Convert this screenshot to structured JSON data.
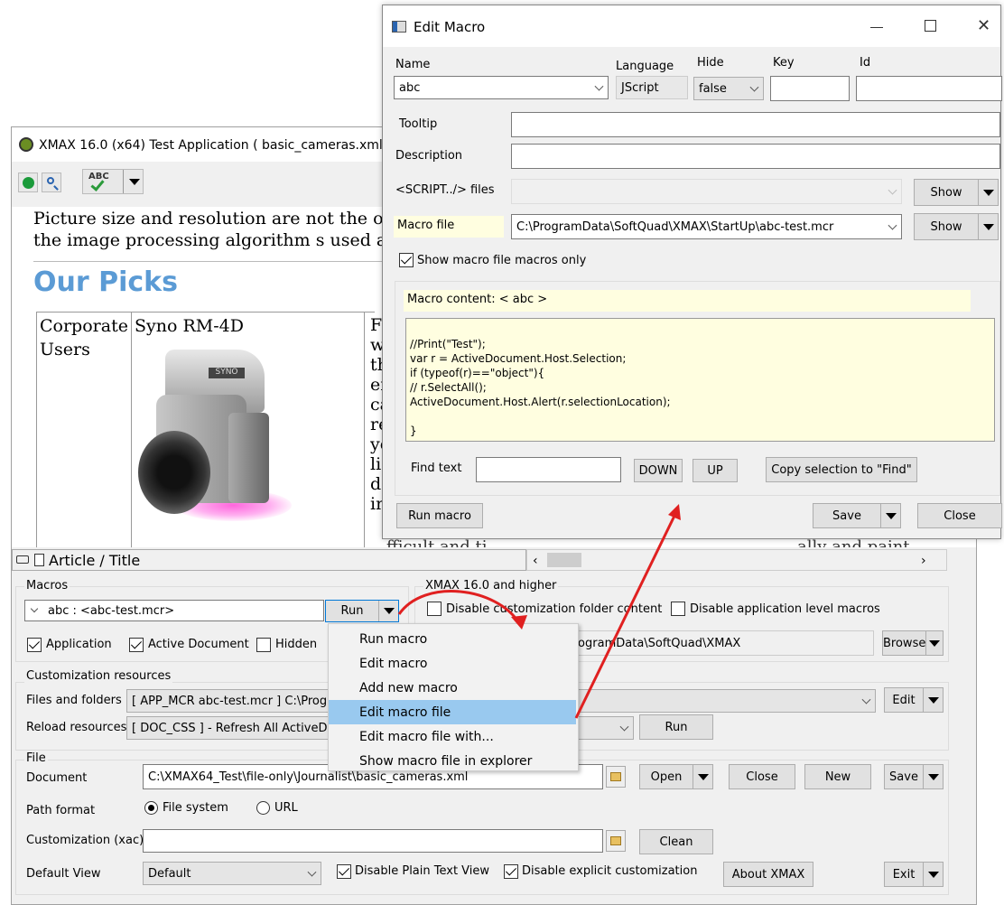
{
  "main": {
    "title": "XMAX 16.0 (x64) Test Application ( basic_cameras.xml )",
    "doc": {
      "para_line1": "Picture size and resolution are not the onl",
      "para_line2": "the image processing algorithm s used also",
      "heading": "Our Picks",
      "cell1_line1": "Corporate",
      "cell1_line2": "Users",
      "cell2": "Syno RM-4D",
      "col3_letters": [
        "F",
        "w",
        "th",
        "er",
        "ca",
        "re",
        "yo",
        "li",
        "d",
        "in"
      ],
      "bottom_text": "fficult and ti",
      "bottom_text2": "ally and paint"
    },
    "status_path": "Article / Title",
    "macros": {
      "label": "Macros",
      "selected": "abc  :  <abc-test.mcr>",
      "run": "Run",
      "application": "Application",
      "active_document": "Active Document",
      "hidden": "Hidden"
    },
    "xmax16": {
      "label": "XMAX 16.0 and higher",
      "disable_custom": "Disable customization folder content",
      "disable_app_macros": "Disable application level macros",
      "path": "rogramData\\SoftQuad\\XMAX",
      "browse": "Browse"
    },
    "custom_res": {
      "label": "Customization resources",
      "files_label": "Files and folders",
      "files_value": "[ APP_MCR abc-test.mcr ]  C:\\Prog",
      "edit": "Edit",
      "reload_label": "Reload resources",
      "reload_value": "[ DOC_CSS  ] - Refresh All ActiveD",
      "run": "Run"
    },
    "file": {
      "label": "File",
      "document_label": "Document",
      "document_value": "C:\\XMAX64_Test\\file-only\\Journalist\\basic_cameras.xml",
      "open": "Open",
      "close": "Close",
      "new": "New",
      "save": "Save",
      "path_format_label": "Path format",
      "file_system": "File system",
      "url": "URL",
      "customization_label": "Customization (xac)",
      "clean": "Clean",
      "default_view_label": "Default View",
      "default_view_value": "Default",
      "disable_plain": "Disable Plain Text View",
      "disable_explicit": "Disable explicit customization",
      "about": "About XMAX",
      "exit": "Exit"
    }
  },
  "menu": {
    "items": [
      "Run macro",
      "Edit macro",
      "Add new macro",
      "Edit macro file",
      "Edit macro file with...",
      "Show macro file in explorer"
    ],
    "highlighted_index": 3,
    "highlight_color": "#99c9ef"
  },
  "dialog": {
    "title": "Edit Macro",
    "name_label": "Name",
    "name_value": "abc",
    "language_label": "Language",
    "language_value": "JScript",
    "hide_label": "Hide",
    "hide_value": "false",
    "key_label": "Key",
    "id_label": "Id",
    "tooltip_label": "Tooltip",
    "description_label": "Description",
    "script_files_label": "<SCRIPT../> files",
    "show": "Show",
    "macro_file_label": "Macro file",
    "macro_file_value": "C:\\ProgramData\\SoftQuad\\XMAX\\StartUp\\abc-test.mcr",
    "show_only": "Show macro file macros only",
    "content_label": "Macro content: < abc >",
    "code": [
      "//Print(\"Test\");",
      "var r = ActiveDocument.Host.Selection;",
      "if (typeof(r)==\"object\"){",
      "//  r.SelectAll();",
      "ActiveDocument.Host.Alert(r.selectionLocation);",
      "",
      "}"
    ],
    "find_label": "Find text",
    "down": "DOWN",
    "up": "UP",
    "copy_sel": "Copy selection to \"Find\"",
    "run_macro": "Run macro",
    "save": "Save",
    "close": "Close"
  },
  "colors": {
    "accent_heading": "#5b9bd5",
    "arrow": "#e02020",
    "code_bg": "#fffee0"
  }
}
